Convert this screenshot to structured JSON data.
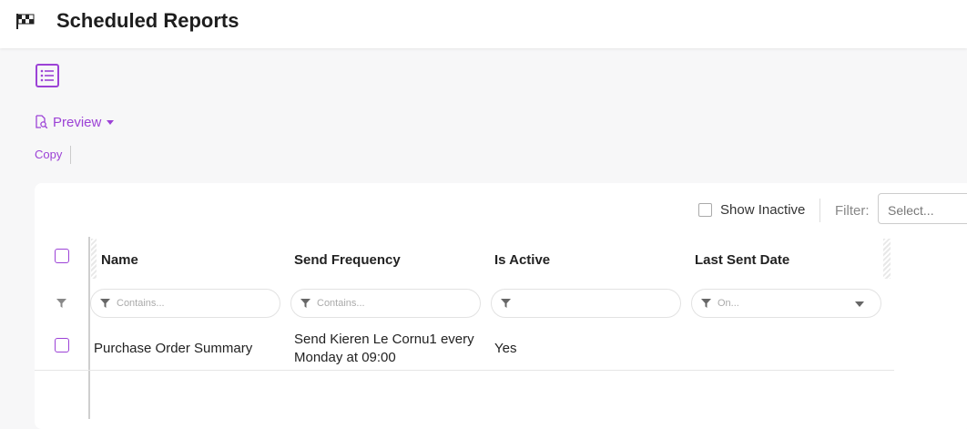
{
  "header": {
    "title": "Scheduled Reports",
    "icon": "checkered-flag-icon"
  },
  "toolbar": {
    "view_icon": "list-view-icon",
    "preview_label": "Preview",
    "copy_label": "Copy"
  },
  "grid_toolbar": {
    "show_inactive_label": "Show Inactive",
    "filter_label": "Filter:",
    "filter_placeholder": "Select..."
  },
  "columns": [
    {
      "label": "Name",
      "filter_placeholder": "Contains..."
    },
    {
      "label": "Send Frequency",
      "filter_placeholder": "Contains..."
    },
    {
      "label": "Is Active",
      "filter_placeholder": ""
    },
    {
      "label": "Last Sent Date",
      "filter_placeholder": "On..."
    }
  ],
  "rows": [
    {
      "name": "Purchase Order Summary",
      "send_frequency_line1": "Send Kieren Le Cornu1 every",
      "send_frequency_line2": "Monday at 09:00",
      "is_active": "Yes",
      "last_sent_date": ""
    }
  ],
  "colors": {
    "accent": "#9c42d6"
  }
}
